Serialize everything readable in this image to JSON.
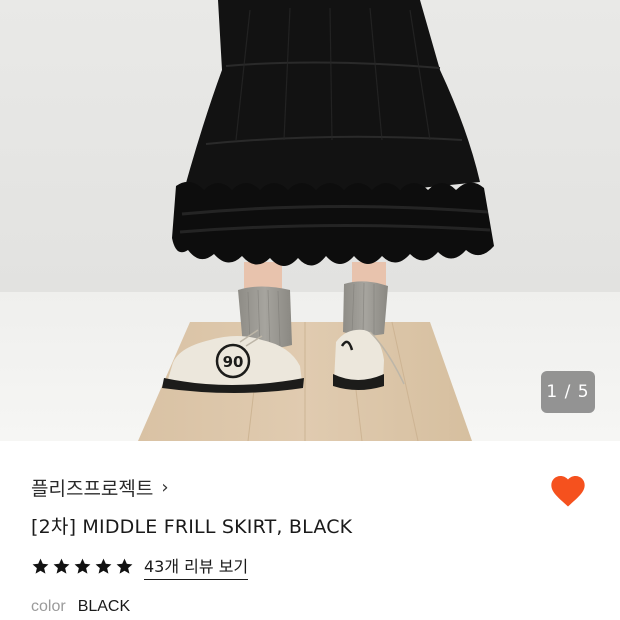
{
  "gallery": {
    "current_page": 1,
    "total_pages": 5,
    "indicator_text": "1 / 5"
  },
  "product": {
    "brand": "플리즈프로젝트",
    "brand_chevron": "›",
    "title": "[2차] MIDDLE FRILL SKIRT, BLACK",
    "rating_stars": 5,
    "review_link": "43개 리뷰 보기",
    "color_label": "color",
    "color_value": "BLACK",
    "wishlisted": true
  },
  "colors": {
    "heart": "#f5511e",
    "stars": "#111111"
  },
  "icons": {
    "wishlist": "heart-icon",
    "star": "star-icon",
    "brand_arrow": "chevron-right-icon"
  }
}
